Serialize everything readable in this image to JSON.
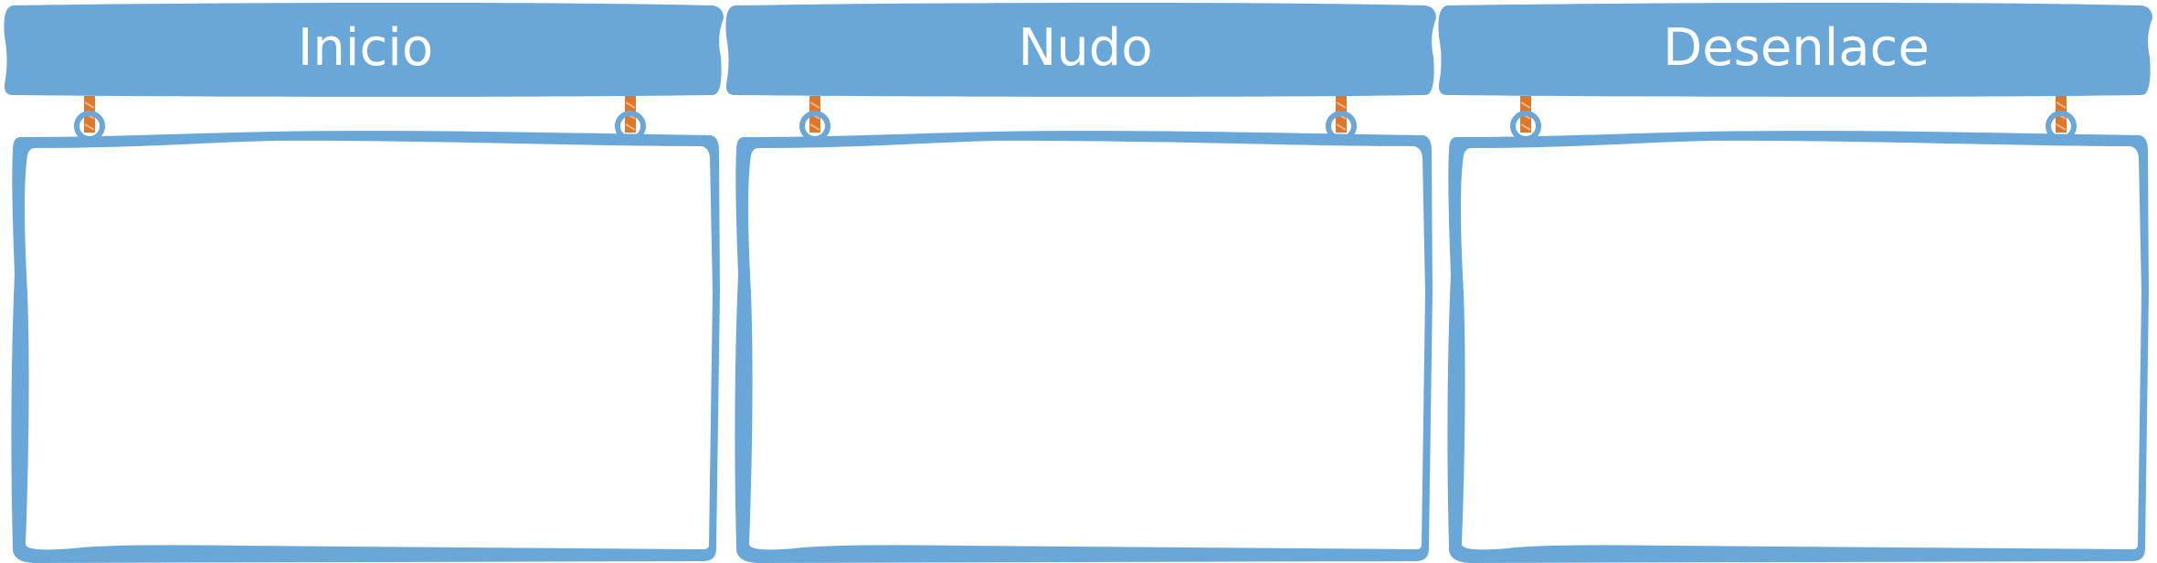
{
  "panels": [
    {
      "title": "Inicio"
    },
    {
      "title": "Nudo"
    },
    {
      "title": "Desenlace"
    }
  ],
  "colors": {
    "board": "#6aa7d9",
    "frame": "#6aa7d9",
    "inner": "#ffffff",
    "rope": "#d9782f",
    "rope_stripe": "#f4b27a",
    "ring": "#6aa7d9"
  }
}
